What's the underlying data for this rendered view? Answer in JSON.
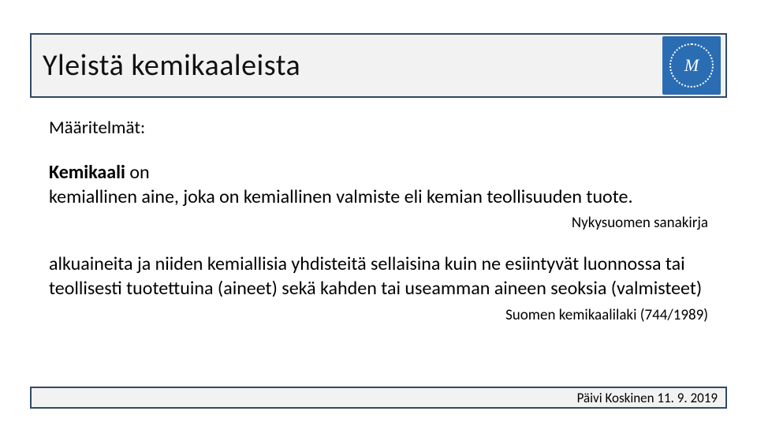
{
  "title": "Yleistä kemikaaleista",
  "logo": {
    "initials": "M",
    "name": "martat-120-logo"
  },
  "subheading": "Määritelmät:",
  "definition1": {
    "term": "Kemikaali",
    "verb": " on",
    "body": "kemiallinen aine, joka on kemiallinen valmiste eli kemian teollisuuden tuote.",
    "source": "Nykysuomen sanakirja"
  },
  "definition2": {
    "body": "alkuaineita ja niiden kemiallisia yhdisteitä sellaisina kuin ne esiintyvät luonnossa tai teollisesti tuotettuina (aineet) sekä kahden tai useamman aineen seoksia (valmisteet)",
    "source": "Suomen kemikaalilaki (744/1989)"
  },
  "footer": "Päivi Koskinen 11. 9. 2019"
}
